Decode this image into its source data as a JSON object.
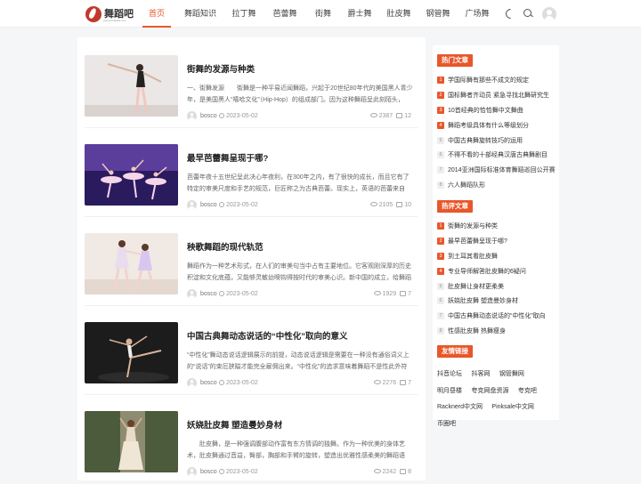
{
  "site": {
    "logo_text": "舞蹈吧",
    "logo_sub": "www.wudaoba.com"
  },
  "nav": [
    {
      "label": "首页",
      "active": true
    },
    {
      "label": "舞蹈知识"
    },
    {
      "label": "拉丁舞"
    },
    {
      "label": "芭蕾舞"
    },
    {
      "label": "街舞"
    },
    {
      "label": "爵士舞"
    },
    {
      "label": "肚皮舞"
    },
    {
      "label": "钢管舞"
    },
    {
      "label": "广场舞"
    }
  ],
  "posts": [
    {
      "title": "街舞的发源与种类",
      "excerpt": "一、街舞发源　　街舞是一种平易近闻舞蹈，兴起于20世纪80年代的美国黑人青少年，是美国黑人“嘻哈文化”（Hip-Hop）的组成部门。因为这种舞蹈呈此刻陌头，",
      "author": "bosco",
      "date": "2023-05-02",
      "views": "2387",
      "comments": "12"
    },
    {
      "title": "最早芭蕾舞呈现于哪?",
      "excerpt": "芭蕾年夜十五世纪呈此决心年夜利，在300年之内，有了很快的成长，而且它有了特定的审美尺度和手艺的规范，巨匠称之为古典芭蕾。现实上，英语的芭蕾来自",
      "author": "bosco",
      "date": "2023-05-02",
      "views": "2105",
      "comments": "10"
    },
    {
      "title": "秧歌舞蹈的现代轨范",
      "excerpt": "舞蹈作为一种艺术形式，在人们的审美句当中占有主要地位。它客观刚深厚的历史积淀和文化底蕴，又能够灵敏幼噢钩得按时代的审美心识。新中国的成立，给舞蹈",
      "author": "bosco",
      "date": "2023-05-02",
      "views": "1929",
      "comments": "7"
    },
    {
      "title": "中国古典舞动态说话的“中性化”取向的意义",
      "excerpt": "“中性化”舞动态说话逻辑展示的前提，动态说话逻辑是需要在一种没有通俗词义上的“说话”的束厄狭隘才能完全雇佣出来。“中性化”的追求意味着舞蹈不是性此外符",
      "author": "bosco",
      "date": "2023-05-02",
      "views": "2276",
      "comments": "7"
    },
    {
      "title": "妖娆肚皮舞 塑造曼妙身材",
      "excerpt": "　　肚皮舞，是一种强调腹部动作富有东方情调的独舞。作为一种优美的身体艺术，肚皮舞通过音益，臀部，胸部和手臂的旋转，塑造出优雅性感柔美的舞蹈语",
      "author": "bosco",
      "date": "2023-05-02",
      "views": "2242",
      "comments": "8"
    }
  ],
  "hot_widget": {
    "title": "热门文章",
    "items": [
      "学国际舞有那些不成文的规定",
      "国标舞者齐动员 紧急寻找北舞研究生",
      "10首经典的恰恰舞中文舞曲",
      "舞蹈考级具体有什么等级划分",
      "中国古典舞旋转技巧的运用",
      "不得不看的十部经典汉唐古典舞剧目",
      "2014亚洲国际标准体育舞蹈巡回公开赛",
      "六人舞蹈队形"
    ]
  },
  "comment_widget": {
    "title": "热评文章",
    "items": [
      "街舞的发源与种类",
      "最早芭蕾舞呈现于哪?",
      "到土耳其看肚皮舞",
      "专业导师解答肚皮舞的6疑问",
      "肚皮舞让身材更柔美",
      "妖娆肚皮舞 塑造曼妙身材",
      "中国古典舞动态说话的“中性化”取向",
      "性感肚皮舞 热舞瘦身"
    ]
  },
  "links_widget": {
    "title": "友情链接",
    "items": [
      "抖音论坛",
      "抖客网",
      "钢管舞网",
      "明月昼楼",
      "夸克网盘资源",
      "夸克吧",
      "Racknerd中文网",
      "Pinksale中文网",
      "币圈吧"
    ]
  },
  "colors": {
    "accent": "#e8572a"
  }
}
